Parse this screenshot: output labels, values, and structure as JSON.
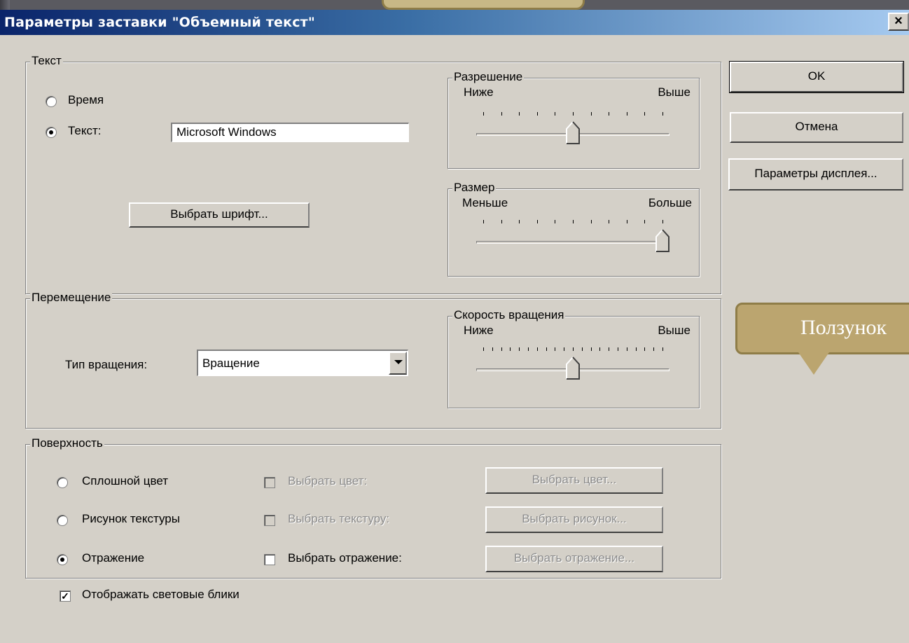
{
  "window": {
    "title": "Параметры заставки \"Объемный текст\"",
    "close_label": "×"
  },
  "text_group": {
    "legend": "Текст",
    "radio_time": "Время",
    "radio_text": "Текст:",
    "text_value": "Microsoft Windows",
    "font_button": "Выбрать шрифт..."
  },
  "resolution": {
    "legend": "Разрешение",
    "low": "Ниже",
    "high": "Выше",
    "ticks": 11,
    "position": 0.5
  },
  "size": {
    "legend": "Размер",
    "low": "Меньше",
    "high": "Больше",
    "ticks": 11,
    "position": 1.0
  },
  "motion": {
    "legend": "Перемещение",
    "rotation_type_label": "Тип вращения:",
    "rotation_type_value": "Вращение"
  },
  "rotation_speed": {
    "legend": "Скорость вращения",
    "low": "Ниже",
    "high": "Выше",
    "ticks": 21,
    "position": 0.5
  },
  "surface": {
    "legend": "Поверхность",
    "solid_color": "Сплошной цвет",
    "texture": "Рисунок текстуры",
    "reflection": "Отражение",
    "choose_color_check": "Выбрать цвет:",
    "choose_texture_check": "Выбрать текстуру:",
    "choose_reflection_check": "Выбрать отражение:",
    "choose_color_btn": "Выбрать цвет...",
    "choose_picture_btn": "Выбрать рисунок...",
    "choose_reflection_btn": "Выбрать отражение...",
    "highlights": "Отображать световые блики"
  },
  "buttons": {
    "ok": "OK",
    "cancel": "Отмена",
    "display": "Параметры дисплея..."
  },
  "callout": {
    "text": "Ползунок"
  }
}
